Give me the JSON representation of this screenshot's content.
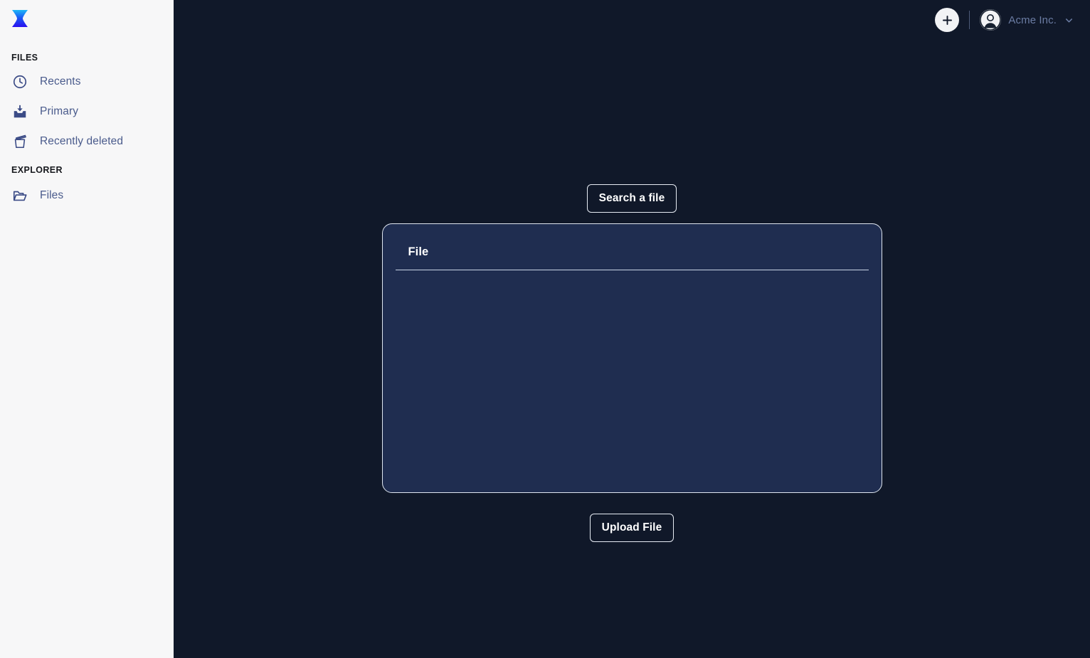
{
  "app": {
    "logo_icon": "hourglass-logo-icon",
    "logo_gradient_from": "#22c0f5",
    "logo_gradient_to": "#1a14f0"
  },
  "theme": {
    "sidebar_bg": "#f7f7f8",
    "main_bg": "#101829",
    "card_bg": "#1f2d50",
    "card_border": "#dfe6f0",
    "nav_icon_color": "#3b4b86",
    "nav_label_color": "#4a5b8c",
    "account_text_color": "#6b7ca3"
  },
  "sidebar": {
    "sections": [
      {
        "title": "FILES",
        "items": [
          {
            "label": "Recents",
            "icon": "clock-icon"
          },
          {
            "label": "Primary",
            "icon": "inbox-download-icon"
          },
          {
            "label": "Recently deleted",
            "icon": "trash-icon"
          }
        ]
      },
      {
        "title": "EXPLORER",
        "items": [
          {
            "label": "Files",
            "icon": "folder-icon"
          }
        ]
      }
    ]
  },
  "topbar": {
    "add_button_icon": "plus-icon",
    "add_button_label": "",
    "avatar_icon": "user-avatar-icon",
    "account_name": "Acme Inc.",
    "chevron_icon": "chevron-down-icon"
  },
  "main": {
    "search_button_label": "Search a file",
    "card": {
      "title": "File",
      "body_text": ""
    },
    "upload_button_label": "Upload File"
  }
}
